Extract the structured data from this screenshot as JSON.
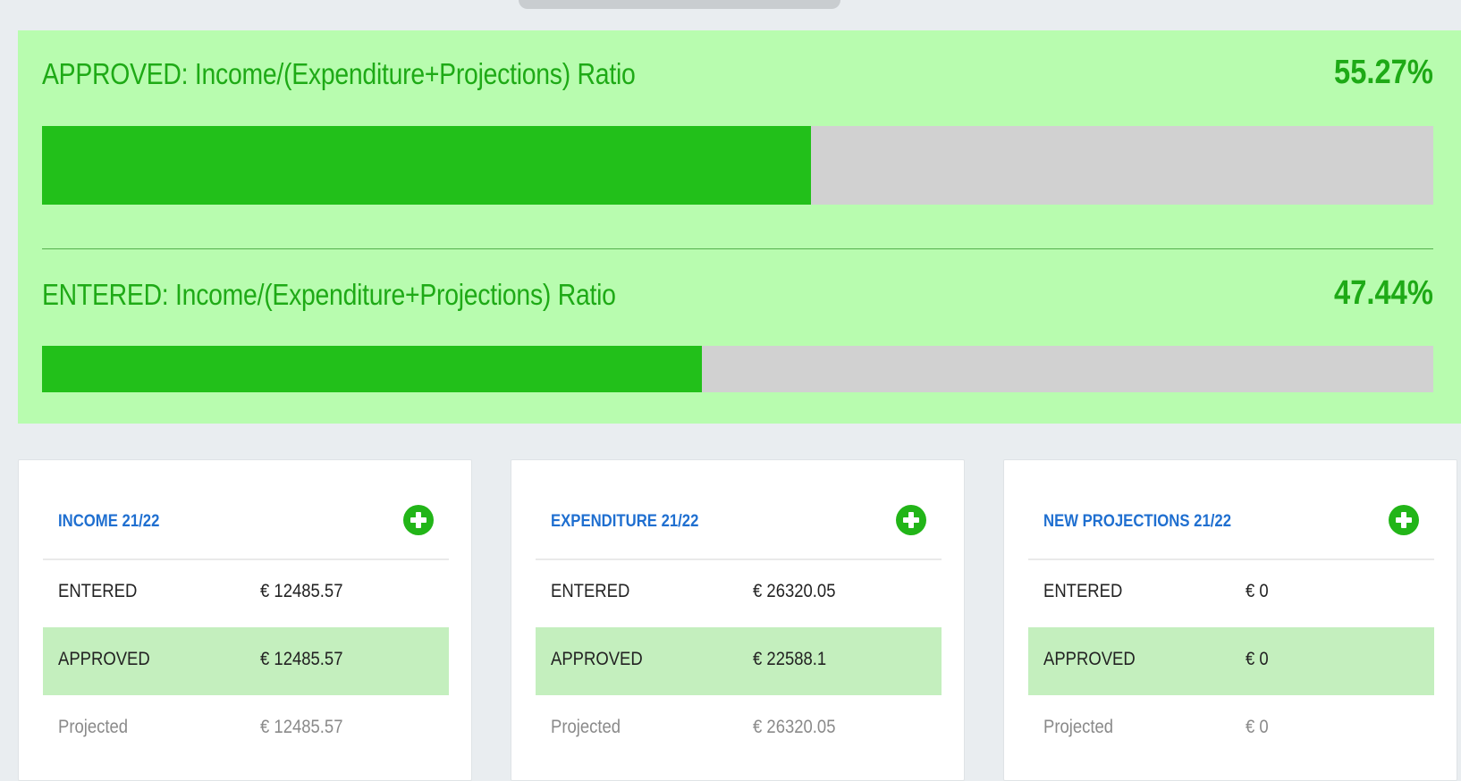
{
  "ratios": {
    "approved": {
      "label": "APPROVED: Income/(Expenditure+Projections) Ratio",
      "value": "55.27%",
      "fill": 0.5527
    },
    "entered": {
      "label": "ENTERED: Income/(Expenditure+Projections) Ratio",
      "value": "47.44%",
      "fill": 0.4744
    }
  },
  "cards": [
    {
      "title": "INCOME 21/22",
      "add_icon": "plus-circle-icon",
      "rows": [
        {
          "label": "ENTERED",
          "value": "€ 12485.57"
        },
        {
          "label": "APPROVED",
          "value": "€ 12485.57"
        },
        {
          "label": "Projected",
          "value": "€ 12485.57"
        }
      ]
    },
    {
      "title": "EXPENDITURE 21/22",
      "add_icon": "plus-circle-icon",
      "rows": [
        {
          "label": "ENTERED",
          "value": "€ 26320.05"
        },
        {
          "label": "APPROVED",
          "value": "€ 22588.1"
        },
        {
          "label": "Projected",
          "value": "€ 26320.05"
        }
      ]
    },
    {
      "title": "NEW PROJECTIONS 21/22",
      "add_icon": "plus-circle-icon",
      "rows": [
        {
          "label": "ENTERED",
          "value": "€ 0"
        },
        {
          "label": "APPROVED",
          "value": "€ 0"
        },
        {
          "label": "Projected",
          "value": "€ 0"
        }
      ]
    }
  ],
  "colors": {
    "panel_background": "#b8fcaf",
    "ratio_text": "#1eaa16",
    "bar_fill": "#22c01a",
    "bar_track": "#d1d1d1",
    "card_title": "#1f6fd0",
    "approved_row": "#c4efbe",
    "add_button": "#22b518"
  }
}
